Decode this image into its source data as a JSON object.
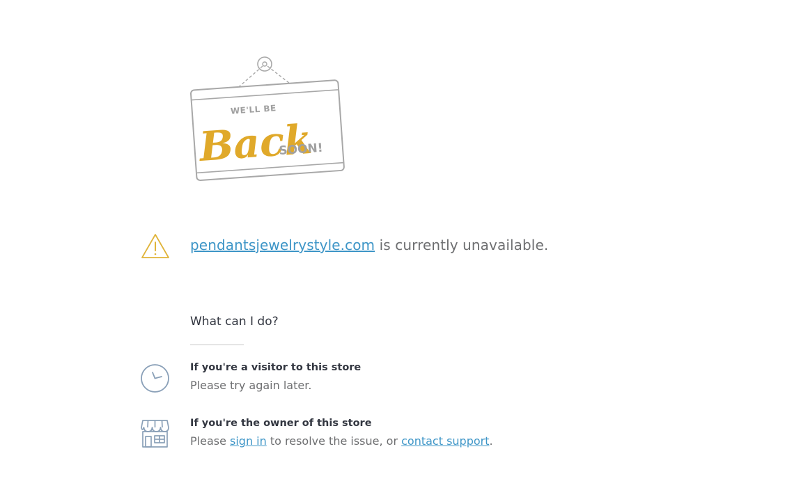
{
  "sign": {
    "line_top": "WE'LL BE",
    "line_main": "Back",
    "line_bottom": "SOON!"
  },
  "status": {
    "domain": "pendantsjewelrystyle.com",
    "message": " is currently unavailable."
  },
  "help": {
    "title": "What can I do?",
    "visitor": {
      "title": "If you're a visitor to this store",
      "text": "Please try again later."
    },
    "owner": {
      "title": "If you're the owner of this store",
      "text_before": "Please ",
      "sign_in_label": "sign in",
      "text_middle": " to resolve the issue, or ",
      "contact_label": "contact support",
      "text_after": "."
    }
  },
  "colors": {
    "accent": "#e0a92a",
    "link": "#3d95c7",
    "icon": "#8aa0b8",
    "sign_frame": "#a8a8a8"
  },
  "icons": {
    "warning": "warning-triangle-icon",
    "clock": "clock-icon",
    "store": "storefront-icon"
  }
}
